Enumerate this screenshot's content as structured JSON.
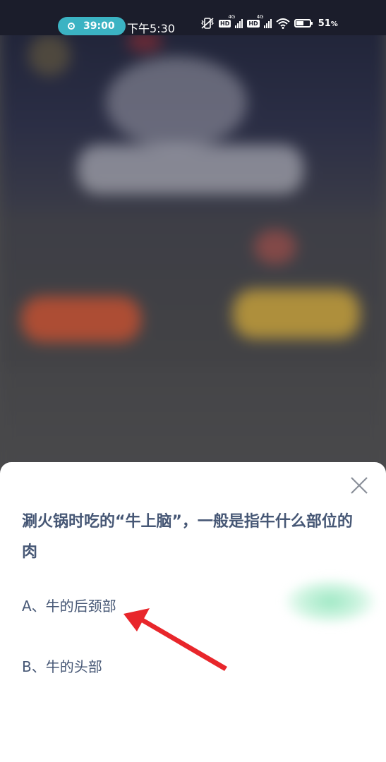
{
  "status_bar": {
    "recording_time": "39:00",
    "clock": "下午5:30",
    "network_badge_1": "HD",
    "network_badge_2": "HD",
    "signal_1_type": "4G",
    "signal_2_type": "4G",
    "battery_percent": "51",
    "battery_unit": "%"
  },
  "quiz": {
    "question": "涮火锅时吃的“牛上脑”，一般是指牛什么部位的肉",
    "options": [
      {
        "label": "A、牛的后颈部"
      },
      {
        "label": "B、牛的头部"
      }
    ]
  },
  "colors": {
    "text": "#465775",
    "pill": "#3bb3c3",
    "arrow": "#e8262b"
  }
}
